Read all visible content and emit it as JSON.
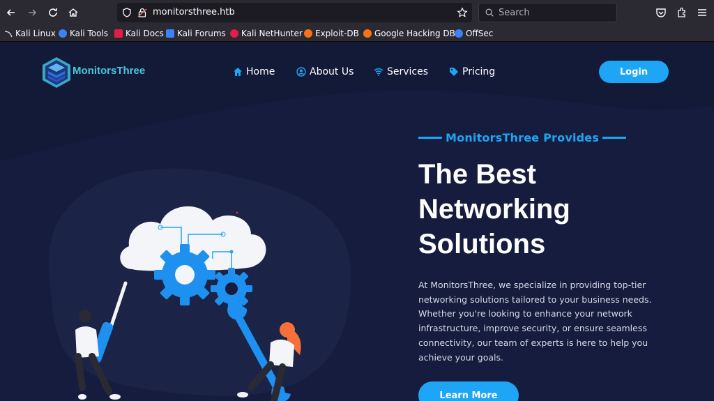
{
  "browser": {
    "url": "monitorsthree.htb",
    "search_placeholder": "Search",
    "bookmarks": [
      {
        "label": "Kali Linux",
        "color": "#9aa0a6"
      },
      {
        "label": "Kali Tools",
        "color": "#3b82f6"
      },
      {
        "label": "Kali Docs",
        "color": "#e11d48"
      },
      {
        "label": "Kali Forums",
        "color": "#3b82f6"
      },
      {
        "label": "Kali NetHunter",
        "color": "#e11d48"
      },
      {
        "label": "Exploit-DB",
        "color": "#f97316"
      },
      {
        "label": "Google Hacking DB",
        "color": "#f97316"
      },
      {
        "label": "OffSec",
        "color": "#3b82f6"
      }
    ]
  },
  "site": {
    "brand": "MonitorsThree",
    "nav": [
      {
        "label": "Home",
        "icon": "home-icon"
      },
      {
        "label": "About Us",
        "icon": "user-circle-icon"
      },
      {
        "label": "Services",
        "icon": "wifi-icon"
      },
      {
        "label": "Pricing",
        "icon": "tag-icon"
      }
    ],
    "login_label": "Login",
    "accent_color": "#1ea5f5",
    "background_color": "#151c3d"
  },
  "hero": {
    "eyebrow": "MonitorsThree Provides",
    "title_line1": "The Best",
    "title_line2": "Networking",
    "title_line3": "Solutions",
    "description": "At MonitorsThree, we specialize in providing top-tier networking solutions tailored to your business needs. Whether you're looking to enhance your network infrastructure, improve security, or ensure seamless connectivity, our team of experts is here to help you achieve your goals.",
    "cta_label": "Learn More"
  }
}
